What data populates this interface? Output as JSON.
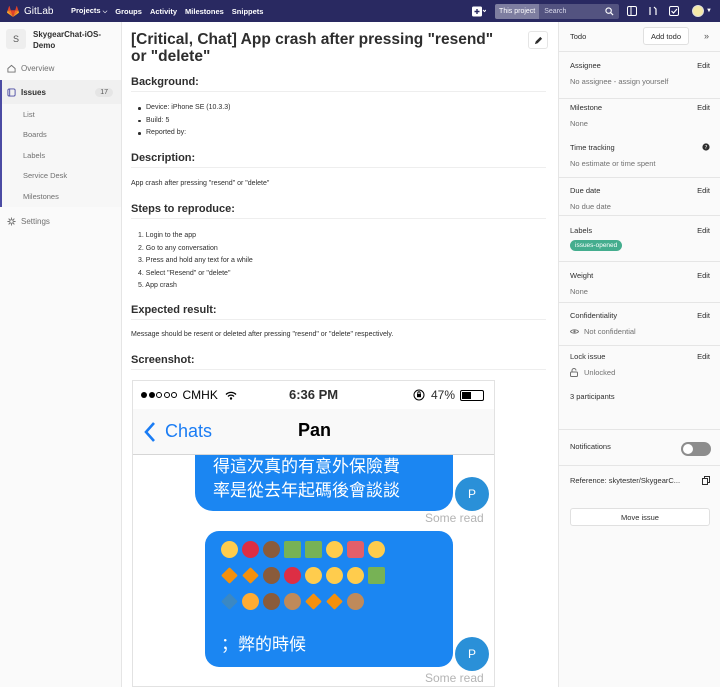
{
  "topbar": {
    "brand": "GitLab",
    "nav": [
      {
        "label": "Projects",
        "caret": true
      },
      {
        "label": "Groups"
      },
      {
        "label": "Activity"
      },
      {
        "label": "Milestones"
      },
      {
        "label": "Snippets"
      }
    ],
    "search_scope": "This project",
    "search_placeholder": "Search",
    "brand_color": "#292961"
  },
  "sidebar": {
    "project_initial": "S",
    "project_name": "SkygearChat-iOS-Demo",
    "items": [
      {
        "label": "Overview",
        "icon": "home-icon"
      },
      {
        "label": "Issues",
        "icon": "issues-icon",
        "count": "17",
        "active": true
      },
      {
        "label": "Settings",
        "icon": "gear-icon"
      }
    ],
    "sub_items": [
      "List",
      "Boards",
      "Labels",
      "Service Desk",
      "Milestones"
    ]
  },
  "issue": {
    "title": "[Critical, Chat] App crash after pressing \"resend\" or \"delete\"",
    "background_heading": "Background:",
    "background_items": [
      "Device: iPhone SE (10.3.3)",
      "Build: 5",
      "Reported by:"
    ],
    "description_heading": "Description:",
    "description": "App crash after pressing \"resend\" or \"delete\"",
    "steps_heading": "Steps to reproduce:",
    "steps": [
      "1. Login to the app",
      "2. Go to any conversation",
      "3. Press and hold any text for a while",
      "4. Select \"Resend\" or \"delete\"",
      "5. App crash"
    ],
    "expected_heading": "Expected result:",
    "expected": "Message should be resent or deleted after pressing \"resend\" or \"delete\" respectively.",
    "screenshot_heading": "Screenshot:"
  },
  "phone": {
    "carrier": "CMHK",
    "time": "6:36 PM",
    "battery": "47%",
    "battery_level": 0.47,
    "back_label": "Chats",
    "chat_title": "Pan",
    "bubble1_line1": "得這次真的有意外保險費",
    "bubble1_line2": "率是從去年起碼後會談談",
    "bubble2_text": "；弊的時候",
    "avatar_letter": "P",
    "status_text": "Some read",
    "bubble_color": "#1b86f2"
  },
  "right_sidebar": {
    "todo_label": "Todo",
    "add_todo": "Add todo",
    "edit_label": "Edit",
    "assignee_title": "Assignee",
    "assignee_value": "No assignee - assign yourself",
    "milestone_title": "Milestone",
    "milestone_value": "None",
    "time_title": "Time tracking",
    "time_value": "No estimate or time spent",
    "due_title": "Due date",
    "due_value": "No due date",
    "labels_title": "Labels",
    "label_pill": "issues-opened",
    "label_color": "#44ad8e",
    "weight_title": "Weight",
    "weight_value": "None",
    "conf_title": "Confidentiality",
    "conf_value": "Not confidential",
    "lock_title": "Lock issue",
    "lock_value": "Unlocked",
    "participants": "3 participants",
    "notifications": "Notifications",
    "reference": "Reference: skytester/SkygearC...",
    "move_issue": "Move issue"
  }
}
